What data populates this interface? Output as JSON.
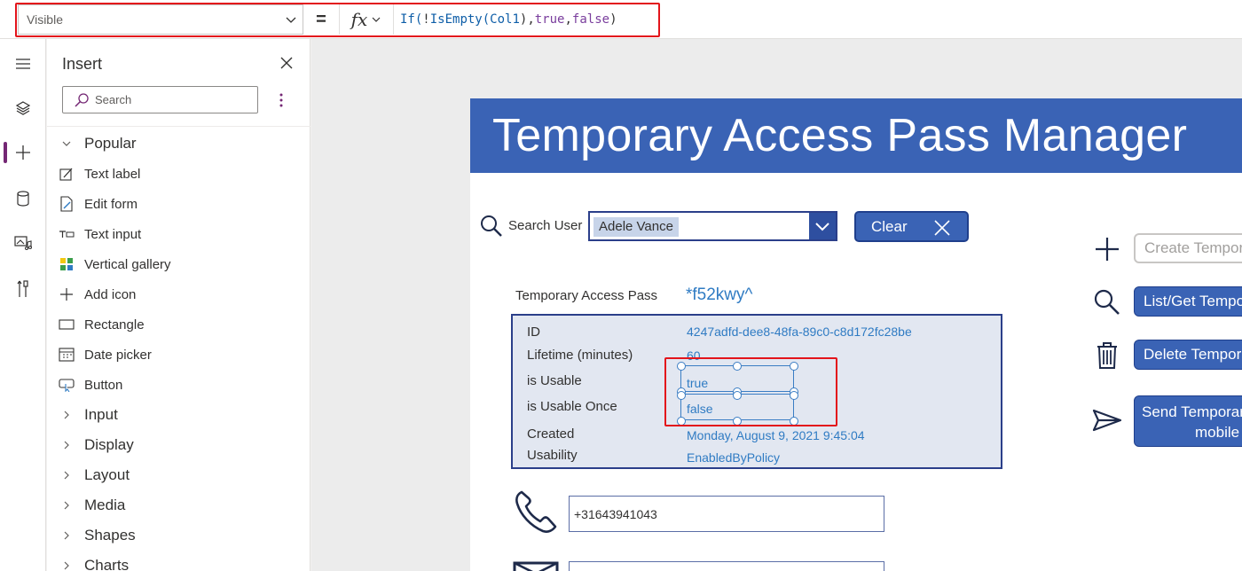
{
  "formula_bar": {
    "property": "Visible",
    "equals": "=",
    "fx_label": "fx",
    "formula": {
      "fn1": "If(",
      "op1": "!",
      "fn2": "IsEmpty(",
      "ref": "Col1",
      "op2": "),",
      "kw1": "true",
      "op3": ",",
      "kw2": "false",
      "op4": ")"
    }
  },
  "rail": {
    "icons": [
      "hamburger-icon",
      "layers-icon",
      "add-icon",
      "data-icon",
      "media-icon",
      "tools-icon"
    ]
  },
  "insert_panel": {
    "title": "Insert",
    "search_placeholder": "Search",
    "popular_label": "Popular",
    "items": [
      {
        "label": "Text label",
        "icon": "text-label-icon"
      },
      {
        "label": "Edit form",
        "icon": "edit-form-icon"
      },
      {
        "label": "Text input",
        "icon": "text-input-icon"
      },
      {
        "label": "Vertical gallery",
        "icon": "gallery-icon"
      },
      {
        "label": "Add icon",
        "icon": "plus-icon"
      },
      {
        "label": "Rectangle",
        "icon": "rectangle-icon"
      },
      {
        "label": "Date picker",
        "icon": "calendar-icon"
      },
      {
        "label": "Button",
        "icon": "button-icon"
      }
    ],
    "categories": [
      "Input",
      "Display",
      "Layout",
      "Media",
      "Shapes",
      "Charts"
    ]
  },
  "app": {
    "title": "Temporary Access Pass Manager",
    "search_label": "Search User",
    "search_value": "Adele Vance",
    "clear_label": "Clear",
    "tap_label": "Temporary Access Pass",
    "tap_value": "*f52kwy^",
    "details": {
      "id_label": "ID",
      "id_value": "4247adfd-dee8-48fa-89c0-c8d172fc28be",
      "lifetime_label": "Lifetime (minutes)",
      "lifetime_value": "60",
      "usable_label": "is Usable",
      "usable_value": "true",
      "usable_once_label": "is Usable Once",
      "usable_once_value": "false",
      "created_label": "Created",
      "created_value": "Monday, August 9, 2021 9:45:04",
      "usability_label": "Usability",
      "usability_value": "EnabledByPolicy"
    },
    "phone_value": "+31643941043",
    "actions": {
      "create": "Create Temporary Access Pass",
      "list": "List/Get Temporary Access Pass",
      "delete": "Delete Temporary Access Pass",
      "send_line1": "Send Temporary Access Pass to",
      "send_line2": "mobile"
    }
  },
  "colors": {
    "header_blue": "#3a63b5",
    "value_blue": "#2f7bc3",
    "highlight_red": "#e3141b",
    "accent_purple": "#742774"
  }
}
